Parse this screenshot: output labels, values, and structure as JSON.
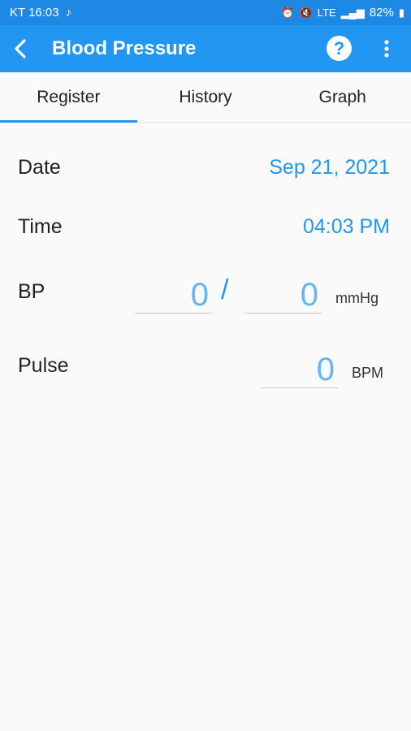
{
  "status_bar": {
    "carrier_time": "KT 16:03",
    "network": "LTE",
    "battery": "82%"
  },
  "app_bar": {
    "title": "Blood Pressure",
    "help_label": "?"
  },
  "tabs": [
    {
      "label": "Register",
      "active": true
    },
    {
      "label": "History",
      "active": false
    },
    {
      "label": "Graph",
      "active": false
    }
  ],
  "form": {
    "date": {
      "label": "Date",
      "value": "Sep 21, 2021"
    },
    "time": {
      "label": "Time",
      "value": "04:03 PM"
    },
    "bp": {
      "label": "BP",
      "systolic": "0",
      "separator": "/",
      "diastolic": "0",
      "unit": "mmHg"
    },
    "pulse": {
      "label": "Pulse",
      "value": "0",
      "unit": "BPM"
    }
  },
  "colors": {
    "status_bar": "#1e88e5",
    "app_bar": "#2196f3",
    "accent": "#2196f3"
  }
}
